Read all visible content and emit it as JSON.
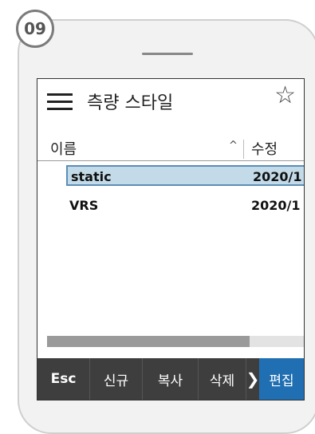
{
  "step_badge": "09",
  "screen": {
    "title": "측량 스타일",
    "columns": {
      "name": "이름",
      "modified": "수정"
    },
    "rows": [
      {
        "name": "static",
        "date": "2020/1"
      },
      {
        "name": "VRS",
        "date": "2020/1"
      }
    ],
    "selected_row": "static",
    "scroll_position_fraction": 0.79,
    "bottom_bar": {
      "esc": "Esc",
      "new": "신규",
      "copy": "복사",
      "delete": "삭제",
      "more": "❯",
      "edit": "편집"
    }
  },
  "icons": {
    "menu": "hamburger-menu-icon",
    "favorite": "star-outline-icon",
    "sort": "sort-ascending-icon"
  },
  "colors": {
    "selection": "#c3dbe8",
    "accent": "#1f6fb2",
    "bottom_bar": "#3e3e3e"
  }
}
